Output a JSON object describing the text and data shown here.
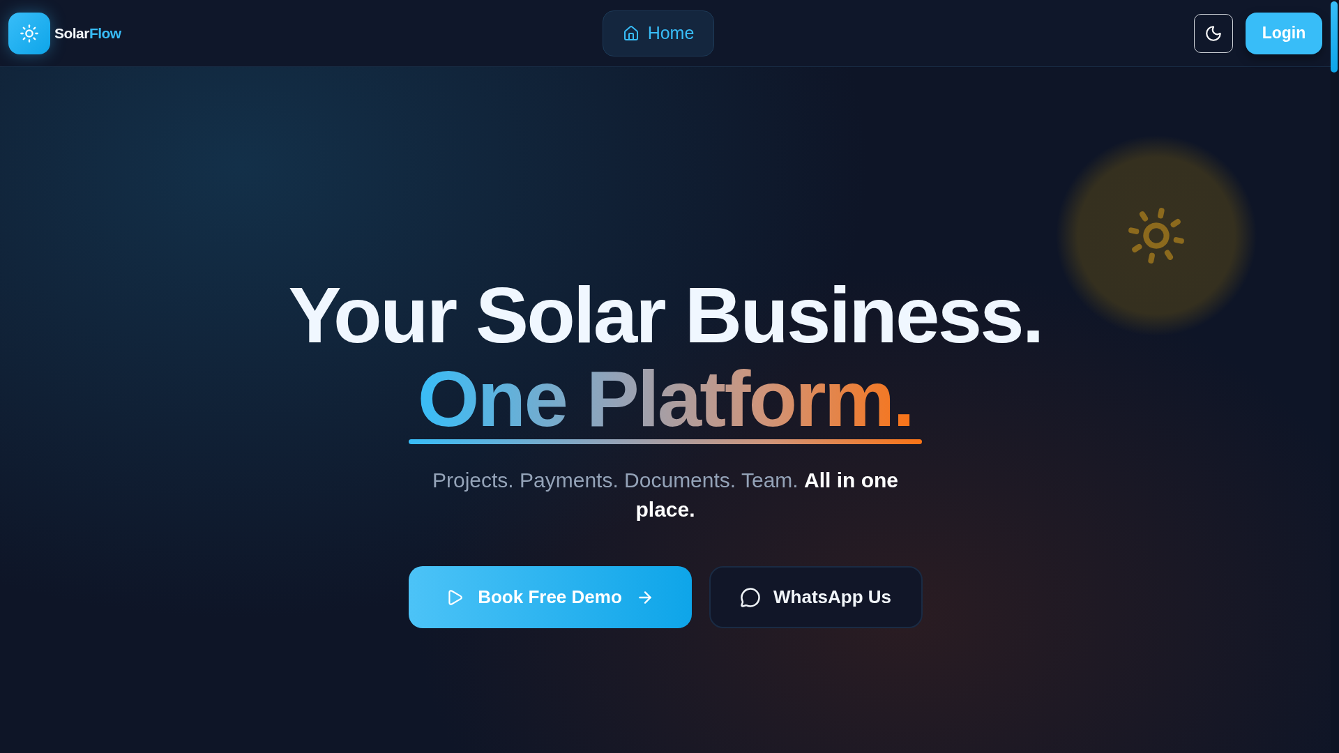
{
  "brand": {
    "name": "Solar",
    "name_accent": "Flow"
  },
  "nav": [
    {
      "label": "Home",
      "selected": true
    }
  ],
  "login_button": {
    "label": "Login"
  },
  "hero": {
    "headline": "Your Solar Business.",
    "headline_accent": "One Platform.",
    "subtitle": "Projects. Payments. Documents. Team. **All in one place.**",
    "buttons": [
      {
        "label": "Book Free Demo",
        "kind": "primary"
      },
      {
        "label": "WhatsApp Us",
        "kind": "secondary"
      }
    ]
  }
}
